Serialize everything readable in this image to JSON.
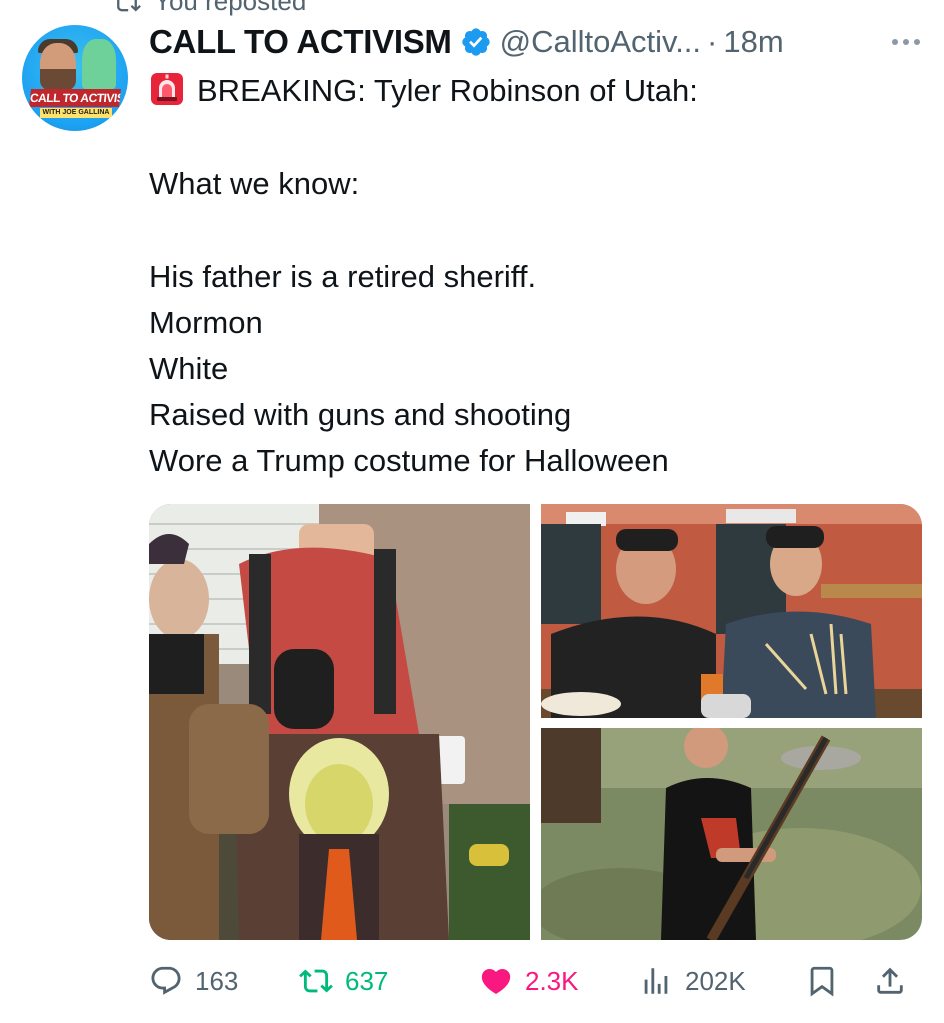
{
  "repost": {
    "label": "You reposted"
  },
  "author": {
    "display_name": "CALL TO ACTIVISM",
    "handle": "@CalltoActiv...",
    "time": "18m",
    "avatar_banner": "CALL TO ACTIVISM",
    "avatar_subbanner": "WITH JOE GALLINA"
  },
  "tweet": {
    "lines": [
      "BREAKING: Tyler Robinson of Utah:",
      "What we know:",
      "His father is a retired sheriff.",
      "Mormon",
      "White",
      "Raised with guns and shooting",
      "Wore a Trump costume for Halloween"
    ]
  },
  "actions": {
    "replies": "163",
    "reposts": "637",
    "likes": "2.3K",
    "views": "202K"
  },
  "colors": {
    "text": "#0f1419",
    "secondary": "#536471",
    "verified": "#1d9bf0",
    "repost_active": "#00ba7c",
    "like_active": "#f91880"
  },
  "icons": [
    "repost-icon",
    "verified-badge-icon",
    "more-icon",
    "siren-icon",
    "reply-icon",
    "retweet-icon",
    "heart-icon",
    "views-icon",
    "bookmark-icon",
    "share-icon"
  ]
}
